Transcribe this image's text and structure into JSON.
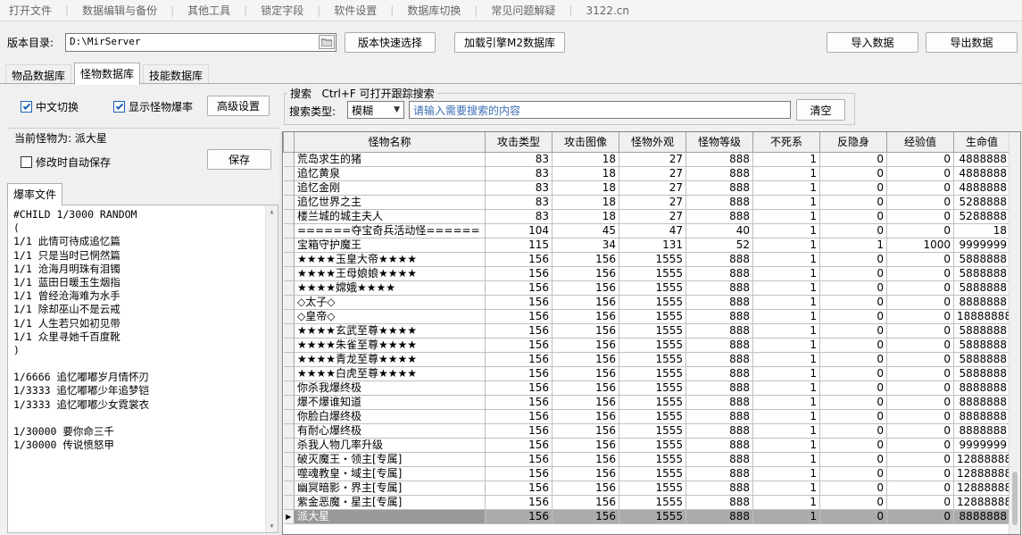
{
  "menu": [
    "打开文件",
    "数据编辑与备份",
    "其他工具",
    "锁定字段",
    "软件设置",
    "数据库切换",
    "常见问题解疑",
    "3122.cn"
  ],
  "toolbar": {
    "dir_label": "版本目录:",
    "dir_value": "D:\\MirServer",
    "quick_select": "版本快速选择",
    "load_db": "加载引擎M2数据库",
    "import": "导入数据",
    "export": "导出数据"
  },
  "tabs": [
    {
      "label": "物品数据库",
      "active": false
    },
    {
      "label": "怪物数据库",
      "active": true
    },
    {
      "label": "技能数据库",
      "active": false
    }
  ],
  "options": {
    "cn_switch": "中文切换",
    "cn_switch_checked": true,
    "show_drop": "显示怪物爆率",
    "show_drop_checked": true,
    "advanced": "高级设置"
  },
  "search": {
    "group_title": "搜索",
    "hint": "Ctrl+F 可打开跟踪搜索",
    "type_label": "搜索类型:",
    "type_value": "模糊",
    "placeholder": "请输入需要搜索的内容",
    "clear": "清空"
  },
  "left": {
    "current_label": "当前怪物为: 派大星",
    "auto_save": "修改时自动保存",
    "auto_save_checked": false,
    "save": "保存",
    "drop_tab": "爆率文件",
    "drop_lines": [
      "#CHILD 1/3000 RANDOM",
      "(",
      "1/1 此情可待成追忆篇",
      "1/1 只是当时已惘然篇",
      "1/1 沧海月明珠有泪镯",
      "1/1 蓝田日暖玉生烟指",
      "1/1 曾经沧海难为水手",
      "1/1 除却巫山不是云戒",
      "1/1 人生若只如初见带",
      "1/1 众里寻她千百度靴",
      ")",
      "",
      "1/6666 追忆嘟嘟岁月情怀刃",
      "1/3333 追忆嘟嘟少年追梦铠",
      "1/3333 追忆嘟嘟少女霓裳衣",
      "",
      "1/30000 要你命三千",
      "1/30000 传说愤怒甲"
    ]
  },
  "grid": {
    "columns": [
      "怪物名称",
      "攻击类型",
      "攻击图像",
      "怪物外观",
      "怪物等级",
      "不死系",
      "反隐身",
      "经验值",
      "生命值"
    ],
    "rows": [
      [
        "荒岛求生的猪",
        "83",
        "18",
        "27",
        "888",
        "1",
        "0",
        "0",
        "4888888"
      ],
      [
        "追忆黄泉",
        "83",
        "18",
        "27",
        "888",
        "1",
        "0",
        "0",
        "4888888"
      ],
      [
        "追忆金刚",
        "83",
        "18",
        "27",
        "888",
        "1",
        "0",
        "0",
        "4888888"
      ],
      [
        "追忆世界之主",
        "83",
        "18",
        "27",
        "888",
        "1",
        "0",
        "0",
        "5288888"
      ],
      [
        "楼兰城的城主夫人",
        "83",
        "18",
        "27",
        "888",
        "1",
        "0",
        "0",
        "5288888"
      ],
      [
        "======夺宝奇兵活动怪======",
        "104",
        "45",
        "47",
        "40",
        "1",
        "0",
        "0",
        "18"
      ],
      [
        "宝箱守护魔王",
        "115",
        "34",
        "131",
        "52",
        "1",
        "1",
        "1000",
        "9999999"
      ],
      [
        "★★★★玉皇大帝★★★★",
        "156",
        "156",
        "1555",
        "888",
        "1",
        "0",
        "0",
        "5888888"
      ],
      [
        "★★★★王母娘娘★★★★",
        "156",
        "156",
        "1555",
        "888",
        "1",
        "0",
        "0",
        "5888888"
      ],
      [
        "★★★★嫦娥★★★★",
        "156",
        "156",
        "1555",
        "888",
        "1",
        "0",
        "0",
        "5888888"
      ],
      [
        "◇太子◇",
        "156",
        "156",
        "1555",
        "888",
        "1",
        "0",
        "0",
        "8888888"
      ],
      [
        "◇皇帝◇",
        "156",
        "156",
        "1555",
        "888",
        "1",
        "0",
        "0",
        "18888888"
      ],
      [
        "★★★★玄武至尊★★★★",
        "156",
        "156",
        "1555",
        "888",
        "1",
        "0",
        "0",
        "5888888"
      ],
      [
        "★★★★朱雀至尊★★★★",
        "156",
        "156",
        "1555",
        "888",
        "1",
        "0",
        "0",
        "5888888"
      ],
      [
        "★★★★青龙至尊★★★★",
        "156",
        "156",
        "1555",
        "888",
        "1",
        "0",
        "0",
        "5888888"
      ],
      [
        "★★★★白虎至尊★★★★",
        "156",
        "156",
        "1555",
        "888",
        "1",
        "0",
        "0",
        "5888888"
      ],
      [
        "你杀我爆终极",
        "156",
        "156",
        "1555",
        "888",
        "1",
        "0",
        "0",
        "8888888"
      ],
      [
        "爆不爆谁知道",
        "156",
        "156",
        "1555",
        "888",
        "1",
        "0",
        "0",
        "8888888"
      ],
      [
        "你脸白爆终极",
        "156",
        "156",
        "1555",
        "888",
        "1",
        "0",
        "0",
        "8888888"
      ],
      [
        "有耐心爆终极",
        "156",
        "156",
        "1555",
        "888",
        "1",
        "0",
        "0",
        "8888888"
      ],
      [
        "杀我人物几率升级",
        "156",
        "156",
        "1555",
        "888",
        "1",
        "0",
        "0",
        "9999999"
      ],
      [
        "破灭魔王・领主[专属]",
        "156",
        "156",
        "1555",
        "888",
        "1",
        "0",
        "0",
        "12888888"
      ],
      [
        "噬魂教皇・域主[专属]",
        "156",
        "156",
        "1555",
        "888",
        "1",
        "0",
        "0",
        "12888888"
      ],
      [
        "幽冥暗影・界主[专属]",
        "156",
        "156",
        "1555",
        "888",
        "1",
        "0",
        "0",
        "12888888"
      ],
      [
        "紫金恶魔・星主[专属]",
        "156",
        "156",
        "1555",
        "888",
        "1",
        "0",
        "0",
        "12888888"
      ],
      [
        "派大星",
        "156",
        "156",
        "1555",
        "888",
        "1",
        "0",
        "0",
        "8888888"
      ]
    ],
    "selected_index": 25
  }
}
